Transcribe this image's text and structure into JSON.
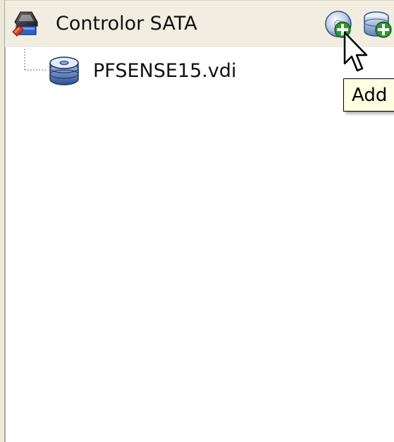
{
  "controller": {
    "label": "Controlor SATA",
    "icon": "sata-controller-icon"
  },
  "toolbar": {
    "add_cd_icon": "add-optical-drive-icon",
    "add_hd_icon": "add-hard-disk-icon"
  },
  "attachments": [
    {
      "label": "PFSENSE15.vdi",
      "icon": "hard-disk-icon"
    }
  ],
  "tooltip": {
    "text": "Add"
  },
  "colors": {
    "row_highlight": "#f1eee1",
    "tooltip_bg": "#ffffe1",
    "add_badge": "#2e9a2e"
  }
}
